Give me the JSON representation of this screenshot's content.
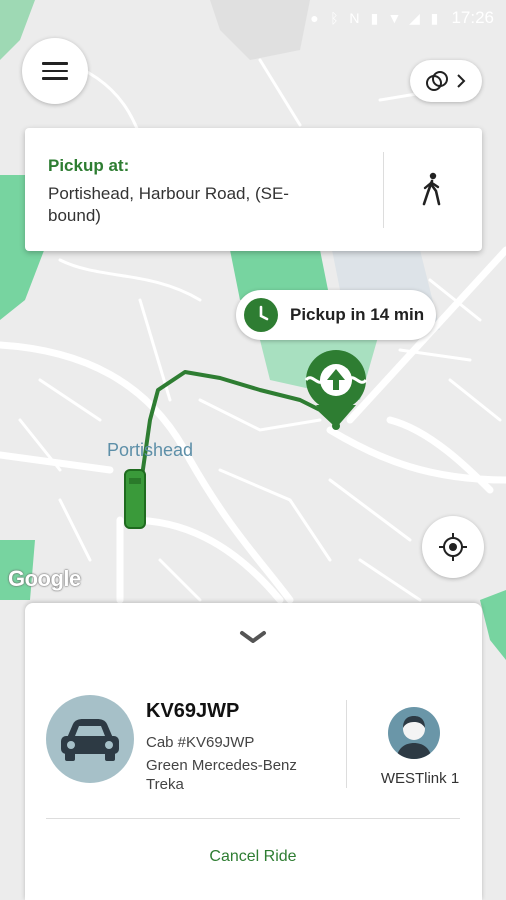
{
  "status_bar": {
    "time": "17:26"
  },
  "map": {
    "place_label": "Portishead",
    "attribution": "Google",
    "route_color": "#2e7d32"
  },
  "pickup_card": {
    "label": "Pickup at:",
    "address": "Portishead, Harbour Road, (SE-bound)"
  },
  "eta": {
    "text": "Pickup in 14 min"
  },
  "ride": {
    "plate": "KV69JWP",
    "cab_id": "Cab #KV69JWP",
    "car_description": "Green Mercedes-Benz Treka",
    "driver_name": "WESTlink 1",
    "cancel_label": "Cancel Ride"
  },
  "icons": {
    "menu": "menu-icon",
    "cycle": "cycle-switch-icon",
    "walk": "walking-person-icon",
    "clock": "clock-icon",
    "locate": "crosshair-icon",
    "chevron": "chevron-down-icon",
    "car": "car-icon",
    "driver": "person-icon"
  },
  "colors": {
    "accent": "#2e7d32",
    "park_green": "#77d4a0",
    "vehicle_avatar_bg": "#a6c0c8",
    "driver_avatar_bg": "#6a96a8"
  }
}
